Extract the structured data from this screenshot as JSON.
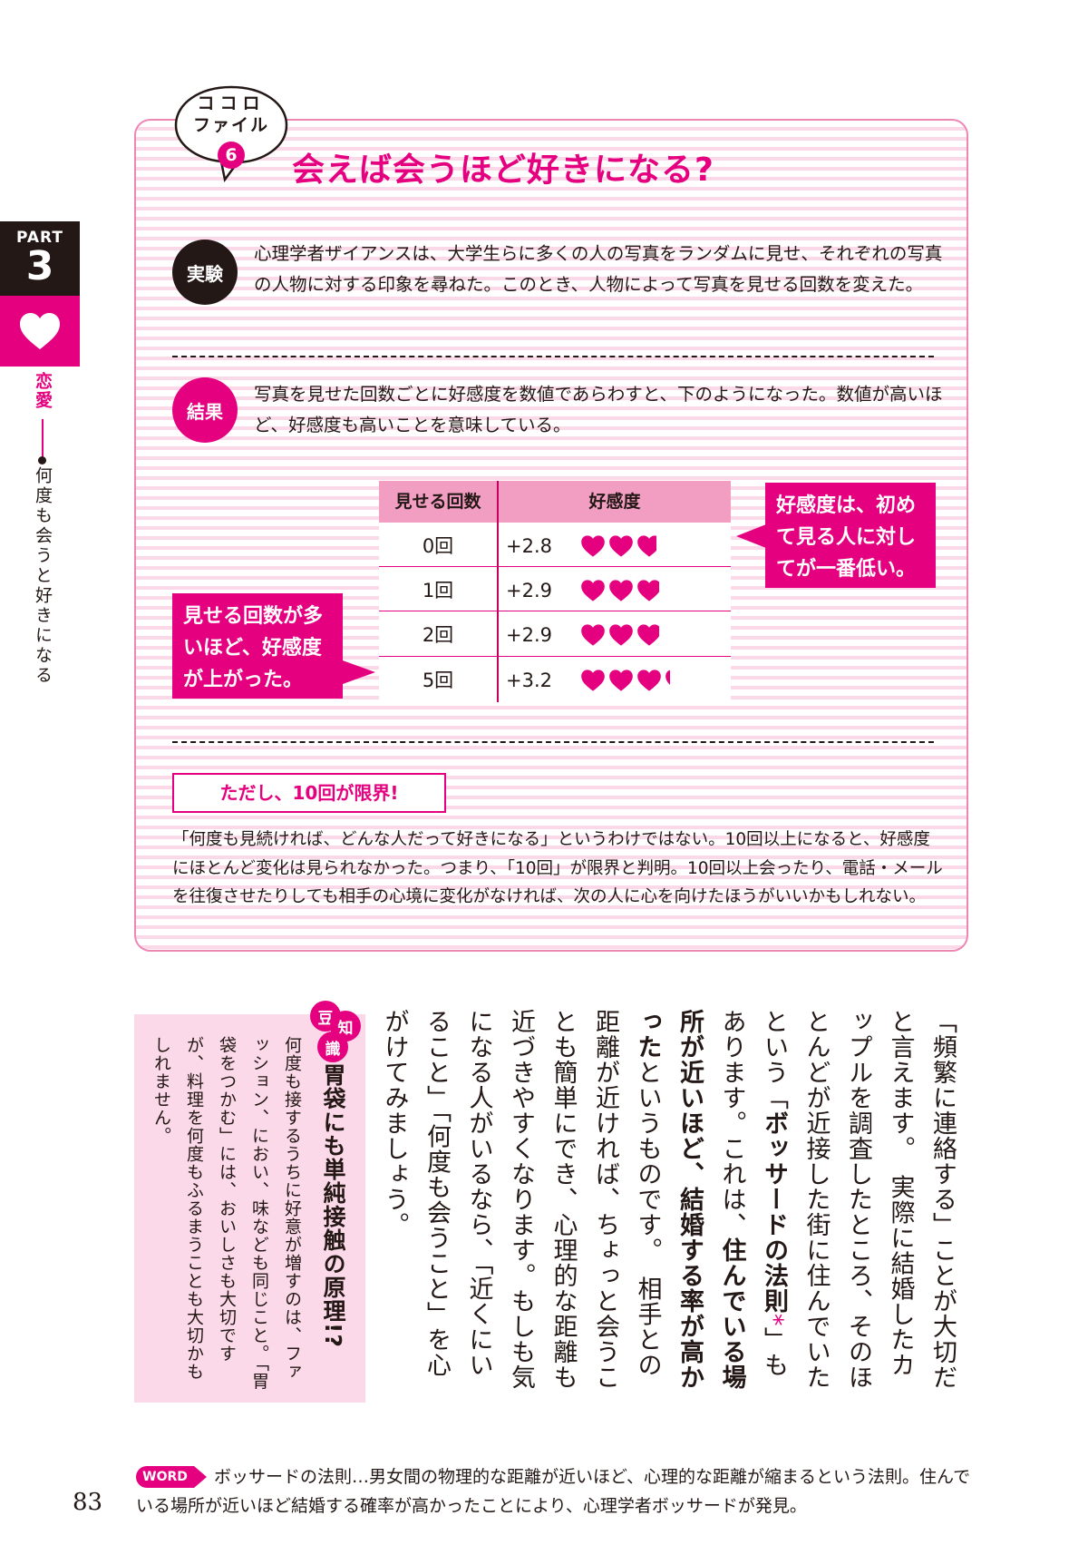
{
  "side": {
    "part_label": "PART",
    "part_number": "3",
    "category": "恋愛",
    "section": "何度も会うと好きになる"
  },
  "header": {
    "bubble_line1": "ココロ",
    "bubble_line2": "ファイル",
    "file_number": "6",
    "title": "会えば会うほど好きになる?"
  },
  "experiment": {
    "label": "実験",
    "text": "心理学者ザイアンスは、大学生らに多くの人の写真をランダムに見せ、それぞれの写真の人物に対する印象を尋ねた。このとき、人物によって写真を見せる回数を変えた。"
  },
  "result": {
    "label": "結果",
    "text": "写真を見せた回数ごとに好感度を数値であらわすと、下のようになった。数値が高いほど、好感度も高いことを意味している。"
  },
  "table": {
    "headers": [
      "見せる回数",
      "好感度"
    ],
    "rows": [
      {
        "count": "0回",
        "score": "+2.8",
        "hearts": 2.8
      },
      {
        "count": "1回",
        "score": "+2.9",
        "hearts": 2.9
      },
      {
        "count": "2回",
        "score": "+2.9",
        "hearts": 2.9
      },
      {
        "count": "5回",
        "score": "+3.2",
        "hearts": 3.2
      }
    ]
  },
  "callouts": {
    "right": "好感度は、初めて見る人に対してが一番低い。",
    "left": "見せる回数が多いほど、好感度が上がった。"
  },
  "limit": {
    "heading": "ただし、10回が限界!",
    "text": "「何度も見続ければ、どんな人だって好きになる」というわけではない。10回以上になると、好感度にほとんど変化は見られなかった。つまり、「10回」が限界と判明。10回以上会ったり、電話・メールを往復させたりしても相手の心境に変化がなければ、次の人に心を向けたほうがいいかもしれない。"
  },
  "trivia": {
    "badge": [
      "豆",
      "知",
      "識"
    ],
    "title": "胃袋にも単純接触の原理!?",
    "text": "何度も接するうちに好意が増すのは、ファッション、におい、味なども同じこと。「胃袋をつかむ」には、おいしさも大切ですが、料理を何度もふるまうことも大切かもしれません。"
  },
  "main_text": {
    "part1": "「頻繁に連絡する」ことが大切だと言えます。　実際に結婚したカップルを調査したところ、そのほとんどが近接した街に住んでいたという「",
    "bold1": "ボッサードの法則",
    "mark": "*",
    "part2": "」もあります。これは、",
    "bold2": "住んでいる場所が近いほど、結婚する率が高かった",
    "part3": "というものです。　相手との距離が近ければ、ちょっと会うことも簡単にでき、心理的な距離も近づきやすくなります。もしも気になる人がいるなら、「近くにいること」「何度も会うこと」を心がけてみましょう。"
  },
  "footer": {
    "page_number": "83",
    "word_label": "WORD",
    "word_text": "ボッサードの法則…男女間の物理的な距離が近いほど、心理的な距離が縮まるという法則。住んでいる場所が近いほど結婚する確率が高かったことにより、心理学者ボッサードが発見。"
  },
  "colors": {
    "accent": "#e4007f",
    "light_pink": "#fbd9e8",
    "header_pink": "#f19ec2",
    "text": "#231815"
  }
}
